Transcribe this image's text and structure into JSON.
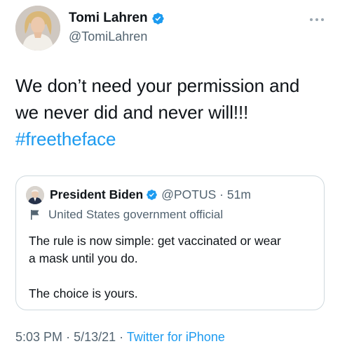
{
  "tweet": {
    "author": {
      "name": "Tomi Lahren",
      "handle": "@TomiLahren"
    },
    "text_lines": [
      "We don’t need your permission and",
      "we never did and never will!!!"
    ],
    "hashtag": "#freetheface",
    "quoted": {
      "name": "President Biden",
      "handle": "@POTUS",
      "separator": "·",
      "time": "51m",
      "label": "United States government official",
      "text_lines": [
        "The rule is now simple: get vaccinated or wear",
        "a mask until you do."
      ],
      "text_line_2": "The choice is yours."
    },
    "footer": {
      "time": "5:03 PM",
      "date": "5/13/21",
      "separator": "·",
      "source": "Twitter for iPhone"
    }
  },
  "colors": {
    "accent": "#1d9bf0",
    "text": "#0f1419",
    "muted": "#536471",
    "border": "#cfd9de"
  },
  "icons": [
    "avatar-photo",
    "verified-badge-icon",
    "more-options-icon",
    "government-flag-icon"
  ]
}
